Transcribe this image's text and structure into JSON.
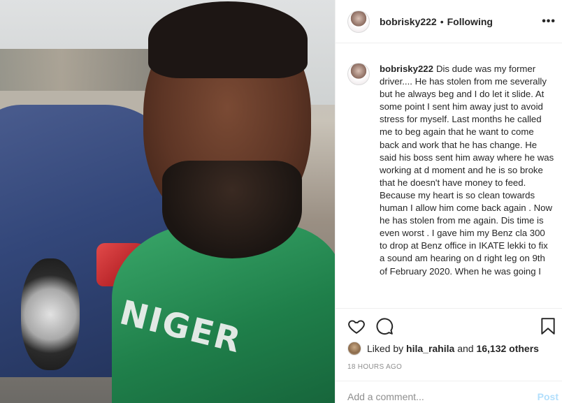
{
  "post": {
    "username": "bobrisky222",
    "separator": "•",
    "follow_status": "Following",
    "more_icon": "more-icon"
  },
  "photo": {
    "jersey_text": "NIGER"
  },
  "caption": {
    "username": "bobrisky222",
    "text": "Dis dude was my former driver.... He has stolen from me severally but he always beg and I do let it slide. At some point I sent him away just to avoid stress for myself. Last months he called me to beg again that he want to come back and work that he has change. He said his boss sent him away where he was working at d moment and he is so broke that he doesn't have money to feed. Because my heart is so clean towards human I allow him come back again . Now he has stolen from me again. Dis time is even worst . I gave him my Benz cla 300 to drop at Benz office in IKATE lekki to fix a sound am hearing on d right leg on 9th of February 2020. When he was going I"
  },
  "actions": {
    "icons": [
      "heart-icon",
      "comment-icon",
      "bookmark-icon"
    ]
  },
  "likes": {
    "prefix": "Liked by",
    "first_user": "hila_rahila",
    "conjunction": "and",
    "others": "16,132 others"
  },
  "timestamp": "18 HOURS AGO",
  "comment_box": {
    "placeholder": "Add a comment...",
    "post_label": "Post"
  }
}
